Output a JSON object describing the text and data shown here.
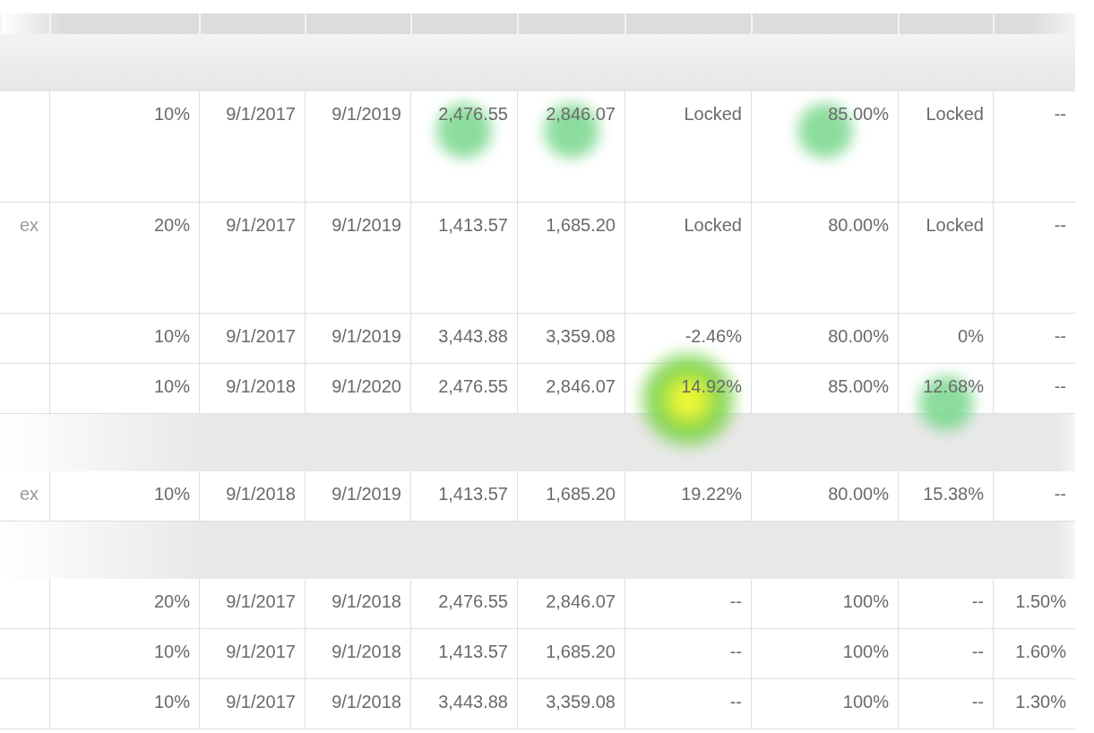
{
  "table": {
    "sections": [
      {
        "rows": [
          {
            "kind": "tall",
            "cells": [
              {
                "text": "10%",
                "kind": "plain"
              },
              {
                "text": "9/1/2017",
                "kind": "plain"
              },
              {
                "text": "9/1/2019",
                "kind": "plain"
              },
              {
                "text": "2,476.55",
                "kind": "warm"
              },
              {
                "text": "2,846.07",
                "kind": "warm"
              },
              {
                "text": "Locked",
                "kind": "plain"
              },
              {
                "text": "85.00%",
                "kind": "warm"
              },
              {
                "text": "Locked",
                "kind": "plain"
              },
              {
                "text": "--",
                "kind": "plain"
              }
            ]
          },
          {
            "kind": "tall",
            "label": "ex",
            "cells": [
              {
                "text": "20%"
              },
              {
                "text": "9/1/2017"
              },
              {
                "text": "9/1/2019"
              },
              {
                "text": "1,413.57"
              },
              {
                "text": "1,685.20"
              },
              {
                "text": "Locked"
              },
              {
                "text": "80.00%"
              },
              {
                "text": "Locked"
              },
              {
                "text": "--"
              }
            ]
          },
          {
            "kind": "normal",
            "cells": [
              {
                "text": "10%"
              },
              {
                "text": "9/1/2017"
              },
              {
                "text": "9/1/2019"
              },
              {
                "text": "3,443.88"
              },
              {
                "text": "3,359.08"
              },
              {
                "text": "-2.46%"
              },
              {
                "text": "80.00%"
              },
              {
                "text": "0%"
              },
              {
                "text": "--"
              }
            ]
          },
          {
            "kind": "normal",
            "cells": [
              {
                "text": "10%",
                "kind": "plain"
              },
              {
                "text": "9/1/2018",
                "kind": "plain"
              },
              {
                "text": "9/1/2020",
                "kind": "plain"
              },
              {
                "text": "2,476.55",
                "kind": "plain"
              },
              {
                "text": "2,846.07",
                "kind": "plain"
              },
              {
                "text": "14.92%",
                "kind": "hot"
              },
              {
                "text": "85.00%",
                "kind": "plain"
              },
              {
                "text": "12.68%",
                "kind": "warm"
              },
              {
                "text": "--",
                "kind": "plain"
              }
            ]
          }
        ]
      },
      {
        "rows": [
          {
            "kind": "normal",
            "label": "ex",
            "cells": [
              {
                "text": "10%"
              },
              {
                "text": "9/1/2018"
              },
              {
                "text": "9/1/2019"
              },
              {
                "text": "1,413.57"
              },
              {
                "text": "1,685.20"
              },
              {
                "text": "19.22%"
              },
              {
                "text": "80.00%"
              },
              {
                "text": "15.38%"
              },
              {
                "text": "--"
              }
            ]
          }
        ]
      },
      {
        "rows": [
          {
            "kind": "normal",
            "cells": [
              {
                "text": "20%"
              },
              {
                "text": "9/1/2017"
              },
              {
                "text": "9/1/2018"
              },
              {
                "text": "2,476.55"
              },
              {
                "text": "2,846.07"
              },
              {
                "text": "--"
              },
              {
                "text": "100%"
              },
              {
                "text": "--"
              },
              {
                "text": "1.50%"
              }
            ]
          },
          {
            "kind": "normal",
            "cells": [
              {
                "text": "10%"
              },
              {
                "text": "9/1/2017"
              },
              {
                "text": "9/1/2018"
              },
              {
                "text": "1,413.57"
              },
              {
                "text": "1,685.20"
              },
              {
                "text": "--"
              },
              {
                "text": "100%"
              },
              {
                "text": "--"
              },
              {
                "text": "1.60%"
              }
            ]
          },
          {
            "kind": "normal",
            "cells": [
              {
                "text": "10%"
              },
              {
                "text": "9/1/2017"
              },
              {
                "text": "9/1/2018"
              },
              {
                "text": "3,443.88"
              },
              {
                "text": "3,359.08"
              },
              {
                "text": "--"
              },
              {
                "text": "100%"
              },
              {
                "text": "--"
              },
              {
                "text": "1.30%"
              }
            ]
          }
        ]
      }
    ]
  }
}
